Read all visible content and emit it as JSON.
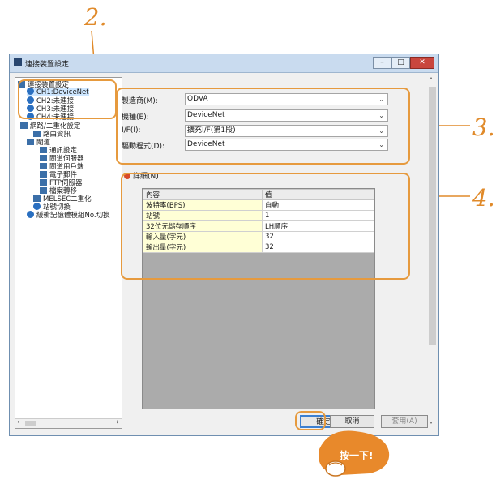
{
  "callouts": {
    "n2": "2.",
    "n3": "3.",
    "n4": "4."
  },
  "window": {
    "title": "連接裝置設定"
  },
  "tree": {
    "root": "連接裝置設定",
    "channels": [
      "CH1:DeviceNet",
      "CH2:未連接",
      "CH3:未連接",
      "CH4:未連接"
    ],
    "items": [
      "網路/二重化設定",
      "路由資訊",
      "閘道",
      "通訊設定",
      "閘道伺服器",
      "閘道用戶端",
      "電子郵件",
      "FTP伺服器",
      "檔案轉移",
      "MELSEC二重化",
      "站號切換",
      "緩衝記憶體模組No.切換"
    ]
  },
  "fields": [
    {
      "label": "製造商(M):",
      "value": "ODVA"
    },
    {
      "label": "機種(E):",
      "value": "DeviceNet"
    },
    {
      "label": "I/F(I):",
      "value": "擴充I/F(第1段)"
    },
    {
      "label": "驅動程式(D):",
      "value": "DeviceNet"
    }
  ],
  "detail": {
    "title": "詳細(N)",
    "columns": [
      "內容",
      "值"
    ],
    "rows": [
      [
        "波特率(BPS)",
        "自動"
      ],
      [
        "站號",
        "1"
      ],
      [
        "32位元儲存順序",
        "LH順序"
      ],
      [
        "輸入量(字元)",
        "32"
      ],
      [
        "輸出量(字元)",
        "32"
      ]
    ]
  },
  "buttons": {
    "ok": "確定",
    "cancel": "取消",
    "apply": "套用(A)"
  },
  "click_badge": "按一下!"
}
